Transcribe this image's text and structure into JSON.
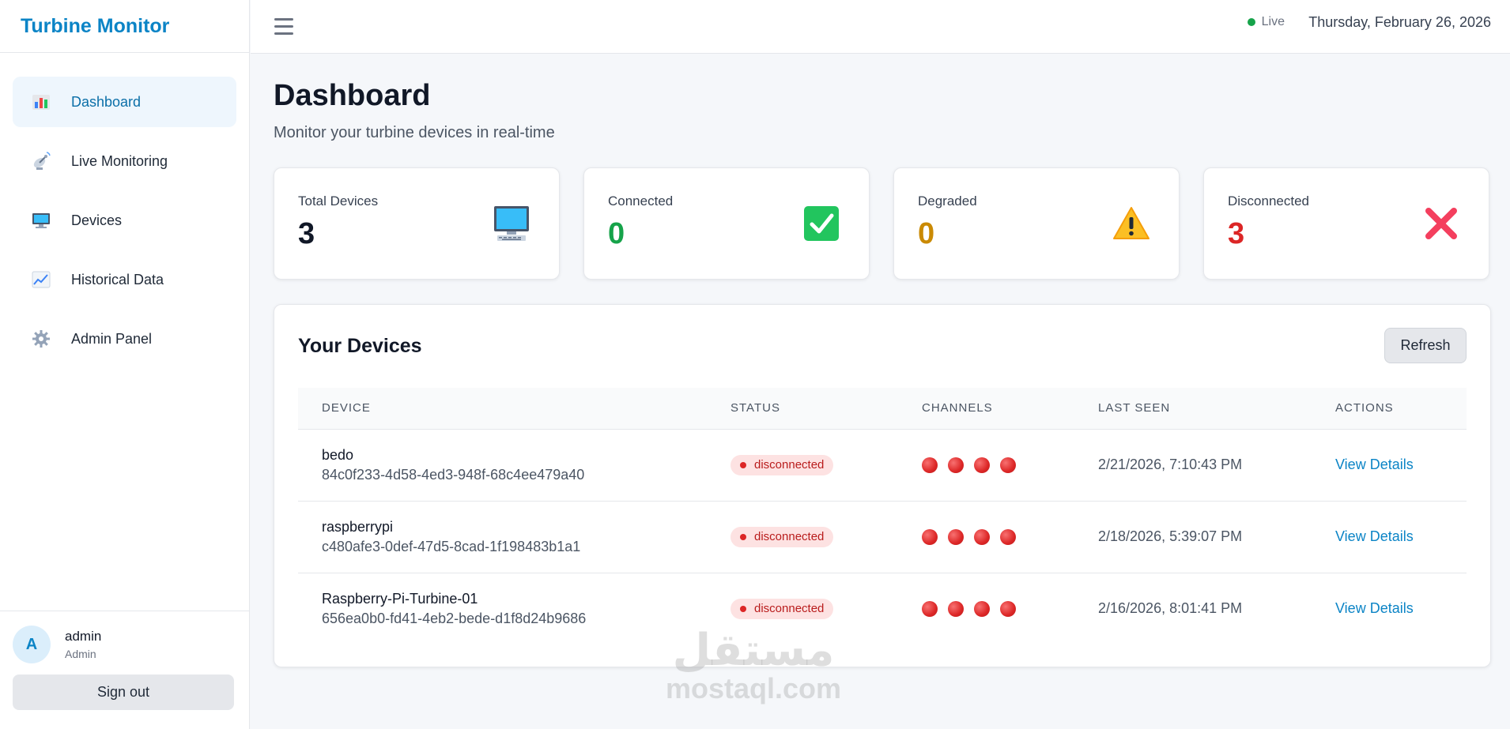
{
  "app": {
    "title": "Turbine Monitor"
  },
  "sidebar": {
    "items": [
      {
        "label": "Dashboard",
        "icon": "bar-chart-icon",
        "active": true
      },
      {
        "label": "Live Monitoring",
        "icon": "satellite-dish-icon"
      },
      {
        "label": "Devices",
        "icon": "desktop-icon"
      },
      {
        "label": "Historical Data",
        "icon": "line-chart-icon"
      },
      {
        "label": "Admin Panel",
        "icon": "gear-icon"
      }
    ],
    "user": {
      "initial": "A",
      "name": "admin",
      "role": "Admin"
    },
    "signout_label": "Sign out"
  },
  "topbar": {
    "live_label": "Live",
    "date": "Thursday, February 26, 2026"
  },
  "page": {
    "title": "Dashboard",
    "subtitle": "Monitor your turbine devices in real-time"
  },
  "stats": [
    {
      "label": "Total Devices",
      "value": "3",
      "color": "#111827",
      "icon": "computer-icon"
    },
    {
      "label": "Connected",
      "value": "0",
      "color": "#16a34a",
      "icon": "check-mark-icon"
    },
    {
      "label": "Degraded",
      "value": "0",
      "color": "#ca8a04",
      "icon": "warning-icon"
    },
    {
      "label": "Disconnected",
      "value": "3",
      "color": "#dc2626",
      "icon": "cross-mark-icon"
    }
  ],
  "devices": {
    "title": "Your Devices",
    "refresh_label": "Refresh",
    "columns": [
      "DEVICE",
      "STATUS",
      "CHANNELS",
      "LAST SEEN",
      "ACTIONS"
    ],
    "rows": [
      {
        "name": "bedo",
        "id": "84c0f233-4d58-4ed3-948f-68c4ee479a40",
        "status": "disconnected",
        "last_seen": "2/21/2026, 7:10:43 PM",
        "action": "View Details"
      },
      {
        "name": "raspberrypi",
        "id": "c480afe3-0def-47d5-8cad-1f198483b1a1",
        "status": "disconnected",
        "last_seen": "2/18/2026, 5:39:07 PM",
        "action": "View Details"
      },
      {
        "name": "Raspberry-Pi-Turbine-01",
        "id": "656ea0b0-fd41-4eb2-bede-d1f8d24b9686",
        "status": "disconnected",
        "last_seen": "2/16/2026, 8:01:41 PM",
        "action": "View Details"
      }
    ]
  },
  "watermark": {
    "arabic": "مستقل",
    "latin": "mostaql.com"
  },
  "colors": {
    "accent": "#0b84c6",
    "live": "#16a34a",
    "disconnected": "#dc2626"
  }
}
